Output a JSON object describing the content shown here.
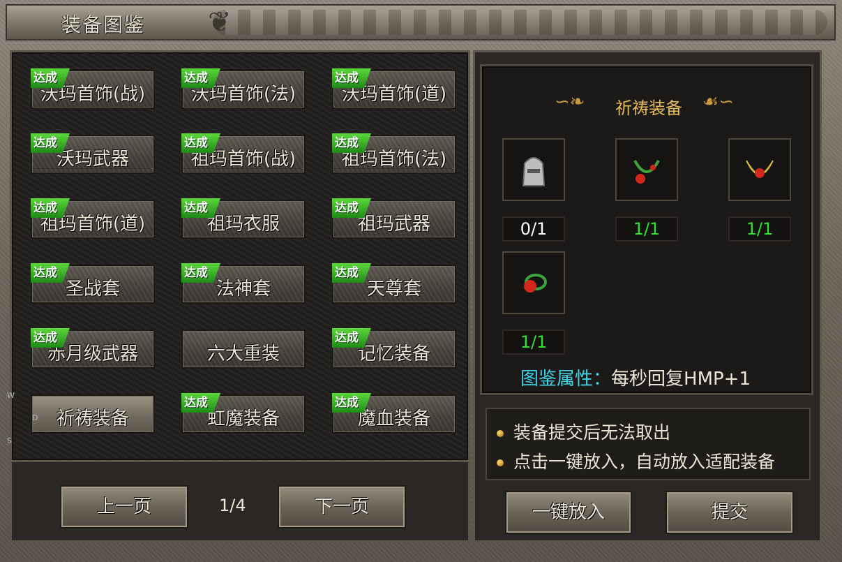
{
  "window": {
    "title": "装备图鉴"
  },
  "left": {
    "badge_text": "达成",
    "cards": [
      {
        "label": "沃玛首饰(战)",
        "achieved": true
      },
      {
        "label": "沃玛首饰(法)",
        "achieved": true
      },
      {
        "label": "沃玛首饰(道)",
        "achieved": true
      },
      {
        "label": "沃玛武器",
        "achieved": true
      },
      {
        "label": "祖玛首饰(战)",
        "achieved": true
      },
      {
        "label": "祖玛首饰(法)",
        "achieved": true
      },
      {
        "label": "祖玛首饰(道)",
        "achieved": true
      },
      {
        "label": "祖玛衣服",
        "achieved": true
      },
      {
        "label": "祖玛武器",
        "achieved": true
      },
      {
        "label": "圣战套",
        "achieved": true
      },
      {
        "label": "法神套",
        "achieved": true
      },
      {
        "label": "天尊套",
        "achieved": true
      },
      {
        "label": "赤月级武器",
        "achieved": true
      },
      {
        "label": "六大重装",
        "achieved": false
      },
      {
        "label": "记忆装备",
        "achieved": true
      },
      {
        "label": "祈祷装备",
        "achieved": false,
        "selected": true
      },
      {
        "label": "虹魔装备",
        "achieved": true
      },
      {
        "label": "魔血装备",
        "achieved": true
      }
    ],
    "prev_label": "上一页",
    "next_label": "下一页",
    "page": "1/4"
  },
  "right": {
    "section_title": "祈祷装备",
    "items": [
      {
        "icon": "helmet-icon",
        "count": "0/1",
        "count_color": "#ffffff"
      },
      {
        "icon": "necklace-icon",
        "count": "1/1",
        "count_color": "#2fe02f"
      },
      {
        "icon": "bracelet-icon",
        "count": "1/1",
        "count_color": "#2fe02f"
      },
      {
        "icon": "ring-icon",
        "count": "1/1",
        "count_color": "#2fe02f"
      }
    ],
    "attr_label": "图鉴属性：",
    "attr_value": "每秒回复HMP+1",
    "notes": [
      "装备提交后无法取出",
      "点击一键放入，自动放入适配装备"
    ],
    "put_all_label": "一键放入",
    "submit_label": "提交"
  },
  "side_letters": [
    "W",
    "D",
    "S"
  ],
  "colors": {
    "achieved_badge": "#2fa31f",
    "count_green": "#2fe02f",
    "title_gold": "#e5b85a",
    "attr_cyan": "#3fd2e6"
  }
}
